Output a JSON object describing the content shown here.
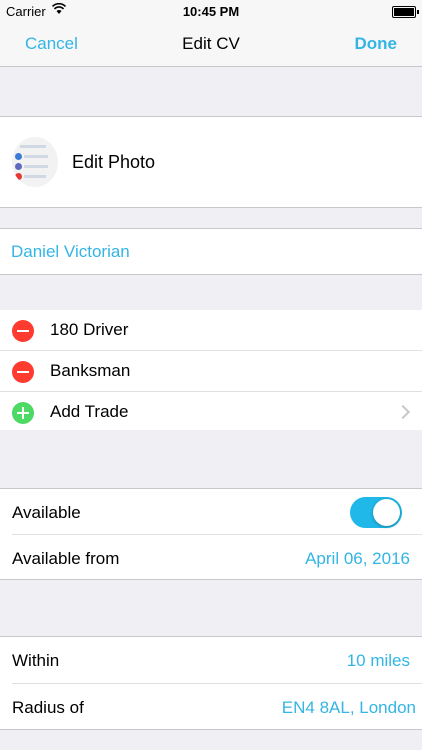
{
  "status_bar": {
    "carrier": "Carrier",
    "time": "10:45 PM"
  },
  "nav": {
    "cancel_label": "Cancel",
    "title": "Edit CV",
    "done_label": "Done"
  },
  "photo": {
    "label": "Edit Photo"
  },
  "profile": {
    "name": "Daniel Victorian"
  },
  "trades": {
    "items": [
      {
        "label": "180 Driver",
        "action": "remove"
      },
      {
        "label": "Banksman",
        "action": "remove"
      }
    ],
    "add_label": "Add Trade"
  },
  "availability": {
    "available_label": "Available",
    "available_on": true,
    "available_from_label": "Available from",
    "available_from_value": "April 06, 2016"
  },
  "location": {
    "within_label": "Within",
    "within_value": "10 miles",
    "radius_label": "Radius of",
    "radius_value": "EN4 8AL, London"
  },
  "colors": {
    "accent": "#33b5e5",
    "remove": "#ff3b30",
    "add": "#4cd964",
    "toggle_on": "#1fb8e8"
  }
}
